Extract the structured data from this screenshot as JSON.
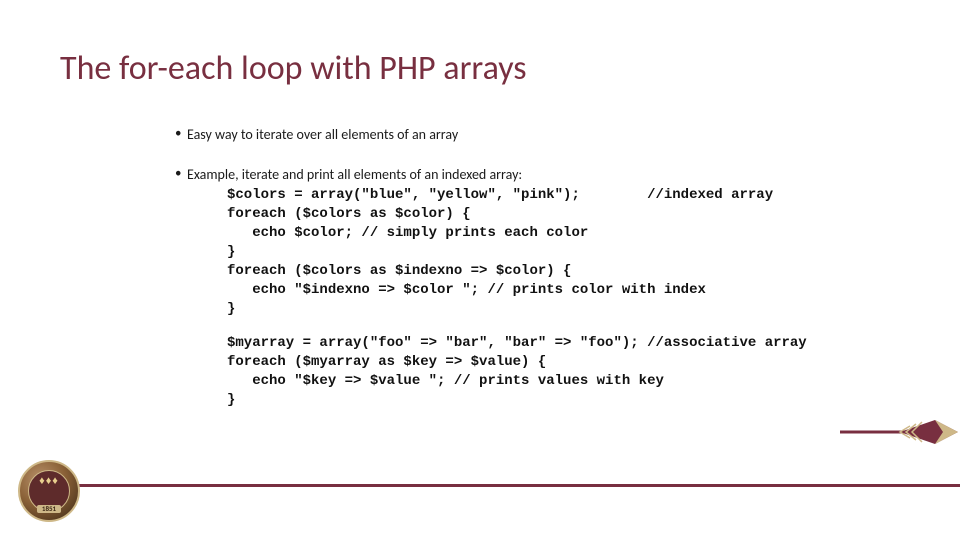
{
  "title": "The for-each loop with PHP arrays",
  "bullets": {
    "b1": "Easy way to iterate over all elements of an array",
    "b2": "Example, iterate and print all elements of an indexed array:"
  },
  "code1": "$colors = array(\"blue\", \"yellow\", \"pink\");        //indexed array\nforeach ($colors as $color) {\n   echo $color; // simply prints each color\n}\nforeach ($colors as $indexno => $color) {\n   echo \"$indexno => $color \"; // prints color with index\n}",
  "code2": "$myarray = array(\"foo\" => \"bar\", \"bar\" => \"foo\"); //associative array\nforeach ($myarray as $key => $value) {\n   echo \"$key => $value \"; // prints values with key\n}",
  "seal_year": "1851"
}
